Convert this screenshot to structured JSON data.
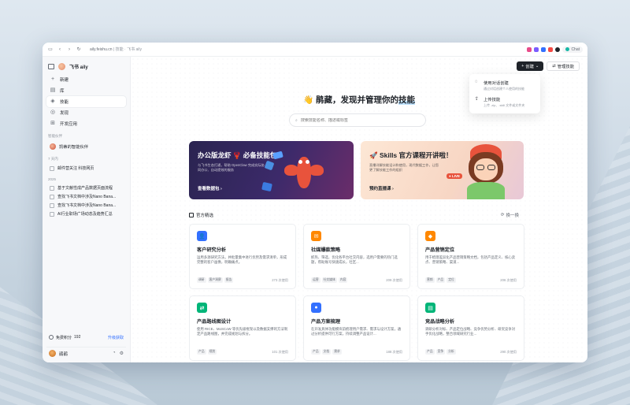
{
  "browser": {
    "url_host": "aily.feishu.cn",
    "url_rest": " | 技能 · 飞书 aily",
    "chat_label": "Chat"
  },
  "sidebar": {
    "brand": "飞书 aily",
    "nav": [
      {
        "icon": "+",
        "label": "新建"
      },
      {
        "icon": "▤",
        "label": "库"
      },
      {
        "icon": "◈",
        "label": "技能"
      },
      {
        "icon": "◎",
        "label": "发现"
      },
      {
        "icon": "⊞",
        "label": "开发应用"
      }
    ],
    "section_agents": "智能伙伴",
    "agent": "凯蒂的智能伙伴",
    "section_recent": "7 天内",
    "recent": [
      "邮件营关注 科技网页"
    ],
    "section_2025": "2025",
    "docs": [
      "基于文献性成产品数据页面流程",
      "查找飞书文档中涉及Nano Bana...",
      "查找飞书文档中涉及Nano Bana...",
      "AI行业职场广场动态及趋势汇总"
    ],
    "credits_label": "免费积分",
    "credits_value": "192",
    "upgrade_label": "升级获取",
    "user_name": "鹃鹃"
  },
  "header": {
    "create_label": "创建",
    "manage_label": "管理技能"
  },
  "dropdown": [
    {
      "title": "使用对话创建",
      "desc": "通过对话创建个人使用的技能"
    },
    {
      "title": "上传技能",
      "desc": "上传 .zip、.skill 文件或文件夹"
    }
  ],
  "hero": {
    "emoji": "👋",
    "title_a": "鹃藏，发现并管理你的",
    "title_b": "技能"
  },
  "search": {
    "placeholder": "搜索技能名称、描述或标签"
  },
  "banners": [
    {
      "title": "办公版龙虾 🦞 必备技能包",
      "sub": "与飞书生态打通，帮助 OpenClaw 完成实际协同办公、自动提效的服务",
      "link": "查看数据包 ›"
    },
    {
      "title": "🚀 Skills 官方课程开讲啦！",
      "sub": "直播详解技能设计和使用，现代数据工作，让您更了解技能工作的组织",
      "link": "预约直播课 ›",
      "live": "● LIVE"
    }
  ],
  "section": {
    "title": "官方精选",
    "refresh": "换一换"
  },
  "cards": [
    {
      "icon": "👤",
      "color": "#3370ff",
      "title": "客户研究分析",
      "desc": "运用多源研究方法，并批量集中进行优势及需求清单，形成完整的客户画像，明确痛点。",
      "tags": [
        "调研",
        "客户洞察",
        "报告"
      ],
      "uses": "273 次使用"
    },
    {
      "icon": "✉",
      "color": "#ff8800",
      "title": "社媒爆款策略",
      "desc": "抓热、筛选、优化各平台社交内容，选用户需要的热门选题，帮助账号快速成长，社区...",
      "tags": [
        "运营",
        "社交媒体",
        "内容"
      ],
      "uses": "209 次使用"
    },
    {
      "icon": "◆",
      "color": "#ff8800",
      "title": "产品营销定位",
      "desc": "用于梳理差异化产品营销策略文档，包括产品定义、核心卖点、营销策略、渠道...",
      "tags": [
        "营销",
        "产品",
        "定位"
      ],
      "uses": "206 次使用"
    },
    {
      "icon": "⇄",
      "color": "#00b578",
      "title": "产品路线图设计",
      "desc": "使用 RICE、MoSCoW 等优先级框架以及数据支撑的方法制定产品路线图，并完成规划与拆分。",
      "tags": [
        "产品",
        "规划"
      ],
      "uses": "101 次使用"
    },
    {
      "icon": "●",
      "color": "#3370ff",
      "title": "产品方案梳理",
      "desc": "在开发具体功能模块前梳理用户需求、需求与设计方案，通过分析提供可行方案，持续调整产品设计...",
      "tags": [
        "产品",
        "文档",
        "需求"
      ],
      "uses": "188 次使用"
    },
    {
      "icon": "▤",
      "color": "#00b578",
      "title": "竞品战略分析",
      "desc": "调研分析对标、产品定位战略、竞争优势分析、研究竞争对手优化战略，整合领域研究行业...",
      "tags": [
        "产品",
        "竞争",
        "分析"
      ],
      "uses": "290 次使用"
    }
  ],
  "stub_colors": [
    "#3370ff",
    "#3370ff",
    "#ff8800"
  ]
}
